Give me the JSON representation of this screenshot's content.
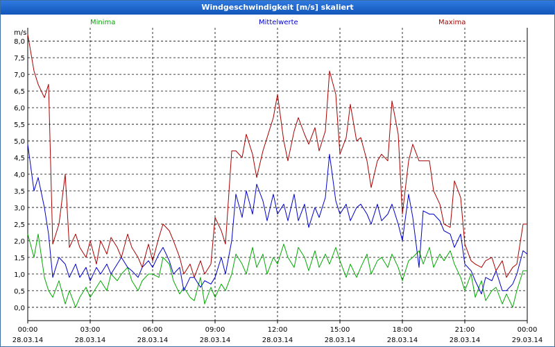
{
  "window": {
    "title": "Windgeschwindigkeit [m/s] skaliert"
  },
  "chart_data": {
    "type": "line",
    "title": "Windgeschwindigkeit [m/s] skaliert",
    "ylabel": "m/s",
    "ylim": [
      -0.4,
      8.4
    ],
    "y_ticks": [
      "0,0",
      "0,5",
      "1,0",
      "1,5",
      "2,0",
      "2,5",
      "3,0",
      "3,5",
      "4,0",
      "4,5",
      "5,0",
      "5,5",
      "6,0",
      "6,5",
      "7,0",
      "7,5",
      "8,0"
    ],
    "x_ticks": [
      {
        "time": "00:00",
        "date": "28.03.14"
      },
      {
        "time": "03:00",
        "date": "28.03.14"
      },
      {
        "time": "06:00",
        "date": "28.03.14"
      },
      {
        "time": "09:00",
        "date": "28.03.14"
      },
      {
        "time": "12:00",
        "date": "28.03.14"
      },
      {
        "time": "15:00",
        "date": "28.03.14"
      },
      {
        "time": "18:00",
        "date": "28.03.14"
      },
      {
        "time": "21:00",
        "date": "28.03.14"
      },
      {
        "time": "00:00",
        "date": "29.03.14"
      }
    ],
    "xlim_hours": [
      0,
      24
    ],
    "grid": true,
    "legend_position": "top",
    "series": [
      {
        "name": "Minima",
        "color": "#00aa00",
        "x": [
          0,
          0.3,
          0.5,
          0.8,
          1.0,
          1.2,
          1.5,
          1.8,
          2.0,
          2.3,
          2.5,
          2.8,
          3.0,
          3.3,
          3.5,
          3.8,
          4.0,
          4.3,
          4.5,
          4.8,
          5.0,
          5.3,
          5.5,
          5.8,
          6.0,
          6.3,
          6.5,
          6.8,
          7.0,
          7.3,
          7.5,
          7.8,
          8.0,
          8.3,
          8.5,
          8.8,
          9.0,
          9.3,
          9.5,
          9.8,
          10.0,
          10.3,
          10.5,
          10.8,
          11.0,
          11.3,
          11.5,
          11.8,
          12.0,
          12.3,
          12.5,
          12.8,
          13.0,
          13.3,
          13.5,
          13.8,
          14.0,
          14.3,
          14.5,
          14.8,
          15.0,
          15.3,
          15.5,
          15.8,
          16.0,
          16.3,
          16.5,
          16.8,
          17.0,
          17.3,
          17.5,
          17.8,
          18.0,
          18.3,
          18.5,
          18.8,
          19.0,
          19.3,
          19.5,
          19.8,
          20.0,
          20.3,
          20.5,
          20.8,
          21.0,
          21.3,
          21.5,
          21.8,
          22.0,
          22.3,
          22.5,
          22.8,
          23.0,
          23.3,
          23.5,
          23.8,
          24.0
        ],
        "y": [
          2.2,
          1.5,
          2.2,
          0.9,
          0.5,
          0.3,
          0.8,
          0.1,
          0.5,
          0.0,
          0.3,
          0.6,
          0.3,
          0.6,
          0.8,
          0.5,
          1.0,
          0.8,
          1.0,
          1.2,
          0.8,
          0.5,
          0.8,
          1.0,
          1.0,
          0.9,
          1.5,
          1.3,
          0.8,
          0.4,
          0.6,
          0.3,
          0.2,
          0.9,
          0.1,
          0.6,
          0.3,
          0.7,
          0.5,
          1.0,
          1.6,
          1.3,
          1.0,
          1.8,
          1.2,
          1.6,
          1.0,
          1.5,
          1.3,
          1.9,
          1.5,
          1.2,
          1.8,
          1.5,
          1.1,
          1.7,
          1.2,
          1.6,
          1.3,
          1.8,
          1.4,
          0.9,
          1.3,
          0.9,
          1.2,
          1.6,
          1.0,
          1.4,
          1.5,
          1.2,
          1.6,
          1.2,
          0.8,
          1.4,
          1.5,
          1.7,
          1.3,
          1.8,
          1.2,
          1.6,
          1.4,
          1.7,
          1.3,
          0.9,
          0.5,
          1.0,
          0.3,
          0.8,
          0.2,
          0.5,
          0.6,
          0.1,
          0.4,
          0.0,
          0.5,
          1.1,
          1.1
        ]
      },
      {
        "name": "Mittelwerte",
        "color": "#0000cc",
        "x": [
          0,
          0.3,
          0.5,
          0.8,
          1.0,
          1.2,
          1.5,
          1.8,
          2.0,
          2.3,
          2.5,
          2.8,
          3.0,
          3.3,
          3.5,
          3.8,
          4.0,
          4.3,
          4.5,
          4.8,
          5.0,
          5.3,
          5.5,
          5.8,
          6.0,
          6.3,
          6.5,
          6.8,
          7.0,
          7.3,
          7.5,
          7.8,
          8.0,
          8.3,
          8.5,
          8.8,
          9.0,
          9.3,
          9.5,
          9.8,
          10.0,
          10.3,
          10.5,
          10.8,
          11.0,
          11.3,
          11.5,
          11.8,
          12.0,
          12.3,
          12.5,
          12.8,
          13.0,
          13.3,
          13.5,
          13.8,
          14.0,
          14.3,
          14.5,
          14.8,
          15.0,
          15.3,
          15.5,
          15.8,
          16.0,
          16.3,
          16.5,
          16.8,
          17.0,
          17.3,
          17.5,
          17.8,
          18.0,
          18.3,
          18.5,
          18.8,
          19.0,
          19.3,
          19.5,
          19.8,
          20.0,
          20.3,
          20.5,
          20.8,
          21.0,
          21.3,
          21.5,
          21.8,
          22.0,
          22.3,
          22.5,
          22.8,
          23.0,
          23.3,
          23.5,
          23.8,
          24.0
        ],
        "y": [
          4.9,
          3.5,
          3.9,
          3.0,
          2.2,
          0.9,
          1.5,
          1.3,
          0.9,
          1.3,
          0.9,
          1.2,
          0.8,
          1.2,
          1.0,
          1.3,
          1.0,
          1.3,
          1.5,
          1.2,
          1.1,
          0.9,
          1.2,
          1.4,
          1.2,
          1.6,
          1.8,
          1.4,
          1.0,
          1.2,
          0.5,
          0.9,
          0.9,
          0.6,
          0.8,
          0.7,
          0.9,
          1.5,
          1.0,
          2.0,
          3.4,
          2.7,
          3.5,
          2.8,
          3.7,
          3.2,
          2.6,
          3.4,
          2.8,
          3.1,
          2.6,
          3.4,
          2.6,
          3.1,
          2.4,
          3.0,
          2.7,
          3.3,
          4.6,
          3.2,
          2.8,
          3.1,
          2.6,
          3.0,
          3.1,
          2.8,
          2.5,
          3.1,
          2.6,
          2.8,
          3.1,
          2.5,
          2.0,
          3.4,
          2.7,
          1.2,
          2.9,
          2.8,
          2.8,
          2.6,
          2.3,
          2.2,
          1.8,
          2.2,
          1.3,
          1.1,
          0.8,
          0.4,
          0.9,
          0.8,
          1.1,
          0.5,
          0.5,
          0.7,
          1.0,
          1.7,
          1.6
        ]
      },
      {
        "name": "Maxima",
        "color": "#aa0000",
        "x": [
          0,
          0.3,
          0.5,
          0.8,
          1.0,
          1.2,
          1.5,
          1.8,
          2.0,
          2.3,
          2.5,
          2.8,
          3.0,
          3.3,
          3.5,
          3.8,
          4.0,
          4.3,
          4.5,
          4.8,
          5.0,
          5.3,
          5.5,
          5.8,
          6.0,
          6.3,
          6.5,
          6.8,
          7.0,
          7.3,
          7.5,
          7.8,
          8.0,
          8.3,
          8.5,
          8.8,
          9.0,
          9.3,
          9.5,
          9.8,
          10.0,
          10.3,
          10.5,
          10.8,
          11.0,
          11.3,
          11.5,
          11.8,
          12.0,
          12.3,
          12.5,
          12.8,
          13.0,
          13.3,
          13.5,
          13.8,
          14.0,
          14.3,
          14.5,
          14.8,
          15.0,
          15.3,
          15.5,
          15.8,
          16.0,
          16.3,
          16.5,
          16.8,
          17.0,
          17.3,
          17.5,
          17.8,
          18.0,
          18.3,
          18.5,
          18.8,
          19.0,
          19.3,
          19.5,
          19.8,
          20.0,
          20.3,
          20.5,
          20.8,
          21.0,
          21.3,
          21.5,
          21.8,
          22.0,
          22.3,
          22.5,
          22.8,
          23.0,
          23.3,
          23.5,
          23.8,
          24.0
        ],
        "y": [
          8.2,
          7.1,
          6.7,
          6.3,
          6.7,
          1.9,
          2.5,
          4.0,
          1.8,
          2.2,
          1.8,
          1.5,
          2.0,
          1.3,
          2.0,
          1.6,
          2.1,
          1.8,
          1.5,
          2.2,
          1.8,
          1.5,
          1.2,
          1.9,
          1.4,
          2.1,
          2.5,
          2.3,
          2.0,
          1.5,
          1.0,
          1.3,
          0.9,
          1.4,
          1.0,
          1.3,
          2.7,
          2.3,
          1.9,
          4.7,
          4.7,
          4.5,
          5.2,
          4.6,
          3.9,
          4.7,
          5.1,
          5.7,
          6.4,
          5.0,
          4.4,
          5.3,
          5.7,
          5.2,
          4.9,
          5.4,
          4.7,
          5.3,
          7.1,
          6.4,
          4.6,
          5.1,
          6.1,
          5.0,
          5.1,
          4.4,
          3.6,
          4.4,
          4.6,
          4.4,
          6.2,
          5.2,
          2.8,
          4.4,
          4.9,
          4.4,
          4.4,
          4.4,
          3.5,
          3.1,
          2.5,
          2.4,
          3.8,
          3.3,
          1.9,
          1.4,
          1.3,
          1.2,
          1.4,
          1.5,
          1.1,
          1.4,
          0.9,
          1.2,
          1.3,
          2.5,
          2.5
        ]
      }
    ]
  }
}
